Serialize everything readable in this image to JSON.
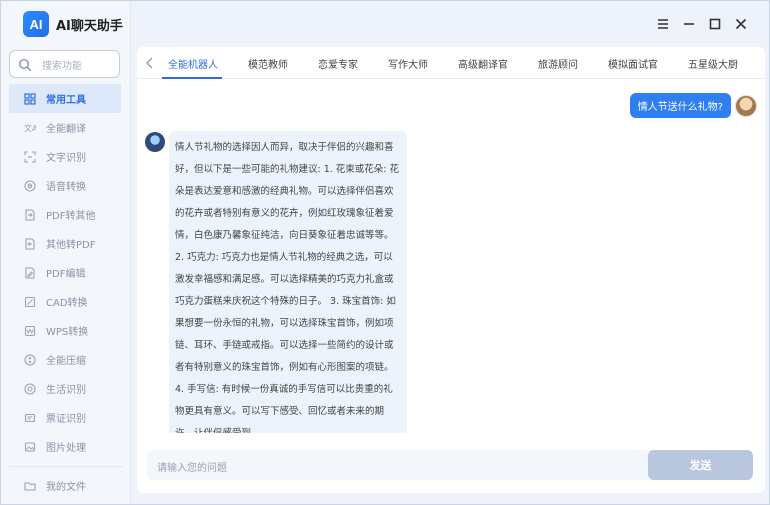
{
  "app": {
    "logo_text": "AI",
    "title": "AI聊天助手"
  },
  "sidebar": {
    "search_placeholder": "搜索功能",
    "items": [
      {
        "label": "常用工具",
        "icon": "grid-icon",
        "active": true
      },
      {
        "label": "全能翻译",
        "icon": "translate-icon"
      },
      {
        "label": "文字识别",
        "icon": "scan-text-icon"
      },
      {
        "label": "语音转换",
        "icon": "audio-icon"
      },
      {
        "label": "PDF转其他",
        "icon": "pdf-convert-icon"
      },
      {
        "label": "其他转PDF",
        "icon": "to-pdf-icon"
      },
      {
        "label": "PDF编辑",
        "icon": "pdf-edit-icon"
      },
      {
        "label": "CAD转换",
        "icon": "cad-icon"
      },
      {
        "label": "WPS转换",
        "icon": "wps-icon"
      },
      {
        "label": "全能压缩",
        "icon": "compress-icon"
      },
      {
        "label": "生活识别",
        "icon": "life-scan-icon"
      },
      {
        "label": "票证识别",
        "icon": "ticket-icon"
      },
      {
        "label": "图片处理",
        "icon": "image-icon"
      }
    ],
    "my_files": "我的文件"
  },
  "tabs": [
    "全能机器人",
    "模范教师",
    "恋爱专家",
    "写作大师",
    "高级翻译官",
    "旅游顾问",
    "模拟面试官",
    "五星级大厨"
  ],
  "chat": {
    "user_message": "情人节送什么礼物?",
    "bot_message": "情人节礼物的选择因人而异，取决于伴侣的兴趣和喜好，但以下是一些可能的礼物建议: 1. 花束或花朵: 花朵是表达爱意和感激的经典礼物。可以选择伴侣喜欢的花卉或者特别有意义的花卉，例如红玫瑰象征着爱情，白色康乃馨象征纯洁，向日葵象征着忠诚等等。 2. 巧克力: 巧克力也是情人节礼物的经典之选，可以激发幸福感和满足感。可以选择精美的巧克力礼盒或巧克力蛋糕来庆祝这个特殊的日子。 3. 珠宝首饰: 如果想要一份永恒的礼物，可以选择珠宝首饰，例如项链、耳环、手链或戒指。可以选择一些简约的设计或者有特别意义的珠宝首饰，例如有心形图案的项链。 4. 手写信: 有时候一份真诚的手写信可以比贵重的礼物更具有意义。可以写下感受、回忆或者未来的期许，让伴侣感受到"
  },
  "input": {
    "placeholder": "请输入您的问题",
    "send_label": "发送"
  },
  "colors": {
    "accent": "#2f6fe0",
    "user_bubble": "#2f7ff0",
    "bot_bubble": "#edf3fc",
    "send_disabled": "#b8c7dd"
  }
}
